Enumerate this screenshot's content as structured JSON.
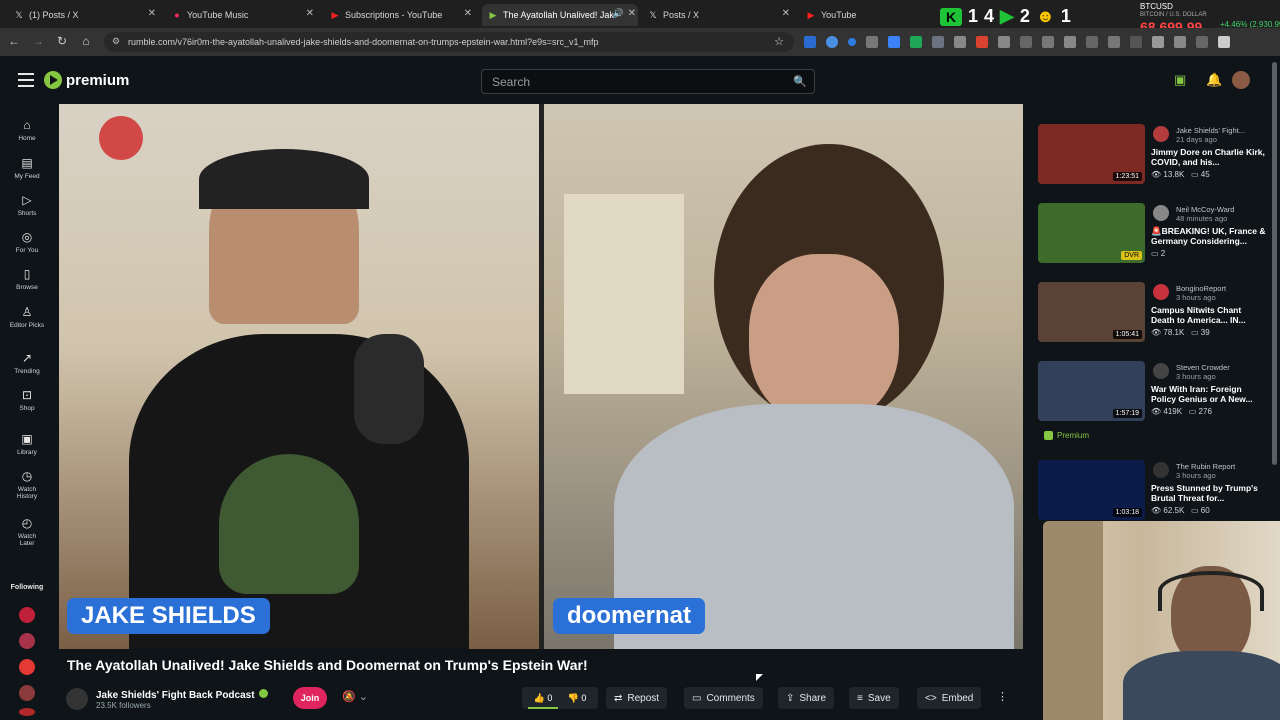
{
  "browser": {
    "tabs": [
      {
        "title": "(1) Posts / X",
        "icon": "x-icon"
      },
      {
        "title": "YouTube Music",
        "icon": "youtube-music-icon"
      },
      {
        "title": "Subscriptions - YouTube",
        "icon": "youtube-icon"
      },
      {
        "title": "The Ayatollah Unalived! Jak",
        "icon": "rumble-icon",
        "active": true
      },
      {
        "title": "Posts / X",
        "icon": "x-icon"
      },
      {
        "title": "YouTube",
        "icon": "youtube-icon"
      }
    ],
    "url": "rumble.com/v76ir0m-the-ayatollah-unalived-jake-shields-and-doomernat-on-trumps-epstein-war.html?e9s=src_v1_mfp",
    "extension_counts": [
      "1",
      "4",
      "2",
      "1"
    ],
    "ticker": {
      "symbol": "BTCUSD",
      "sub": "BITCOIN / U.S. DOLLAR",
      "price": "68,699.99",
      "change": "+4.46% (2,930.99)"
    }
  },
  "header": {
    "logo_text": "premium",
    "search_placeholder": "Search"
  },
  "sidebar": {
    "items": [
      {
        "label": "Home",
        "icon": "home-icon"
      },
      {
        "label": "My Feed",
        "icon": "feed-icon"
      },
      {
        "label": "Shorts",
        "icon": "shorts-icon"
      },
      {
        "label": "For You",
        "icon": "for-you-icon"
      },
      {
        "label": "Browse",
        "icon": "browse-icon"
      },
      {
        "label": "Editor Picks",
        "icon": "editor-picks-icon"
      },
      {
        "label": "Trending",
        "icon": "trending-icon"
      },
      {
        "label": "Shop",
        "icon": "shop-icon"
      },
      {
        "label": "Library",
        "icon": "library-icon"
      },
      {
        "label": "Watch History",
        "icon": "history-icon"
      },
      {
        "label": "Watch Later",
        "icon": "watch-later-icon"
      }
    ],
    "following_label": "Following"
  },
  "video": {
    "name_left": "JAKE SHIELDS",
    "name_right": "doomernat",
    "title": "The Ayatollah Unalived! Jake Shields and Doomernat on Trump's Epstein War!",
    "channel": "Jake Shields' Fight Back Podcast",
    "followers": "23.5K followers",
    "join_label": "Join",
    "likes": "0",
    "dislikes": "0",
    "actions": {
      "repost": "Repost",
      "comments": "Comments",
      "share": "Share",
      "save": "Save",
      "embed": "Embed"
    }
  },
  "recommendations": [
    {
      "channel": "Jake Shields' Fight...",
      "age": "21 days ago",
      "title": "Jimmy Dore on Charlie Kirk, COVID, and his...",
      "views": "13.8K",
      "comments": "45",
      "duration": "1:23:51",
      "thumb_color": "#7d2a25",
      "avatar_color": "#b43c3c"
    },
    {
      "channel": "Neil McCoy-Ward",
      "age": "48 minutes ago",
      "title": "🚨BREAKING! UK, France & Germany Considering...",
      "views": "",
      "comments": "2",
      "duration": "DVR",
      "thumb_color": "#3d6b2c",
      "avatar_color": "#888"
    },
    {
      "channel": "BonginoReport",
      "age": "3 hours ago",
      "title": "Campus Nitwits Chant Death to America... IN...",
      "views": "78.1K",
      "comments": "39",
      "duration": "1:05:41",
      "thumb_color": "#5a4234",
      "avatar_color": "#c8323c"
    },
    {
      "channel": "Steven Crowder",
      "age": "3 hours ago",
      "title": "War With Iran: Foreign Policy Genius or A New...",
      "views": "419K",
      "comments": "276",
      "duration": "1:57:19",
      "thumb_color": "#33405a",
      "avatar_color": "#444"
    },
    {
      "channel": "The Rubin Report",
      "age": "3 hours ago",
      "title": "Press Stunned by Trump's Brutal Threat for...",
      "views": "62.5K",
      "comments": "60",
      "duration": "1:03:18",
      "thumb_color": "#0c1c4a",
      "avatar_color": "#333"
    }
  ],
  "premium_tag": "Premium"
}
